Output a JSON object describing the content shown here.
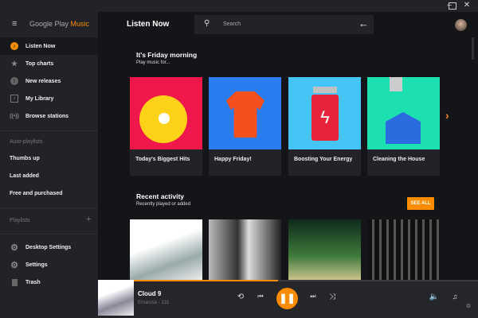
{
  "window": {
    "controls": [
      "minimize",
      "maximize",
      "close"
    ]
  },
  "sidebar": {
    "logo_google": "Google Play",
    "logo_music": "Music",
    "items": [
      {
        "label": "Listen Now",
        "icon": "listen-now-icon",
        "active": true
      },
      {
        "label": "Top charts",
        "icon": "star-icon"
      },
      {
        "label": "New releases",
        "icon": "new-releases-icon"
      },
      {
        "label": "My Library",
        "icon": "library-icon"
      },
      {
        "label": "Browse stations",
        "icon": "radio-icon"
      }
    ],
    "auto_playlists_header": "Auto-playlists",
    "auto_playlists": [
      "Thumbs up",
      "Last added",
      "Free and purchased"
    ],
    "playlists_header": "Playlists",
    "bottom": [
      {
        "label": "Desktop Settings",
        "icon": "gear-icon"
      },
      {
        "label": "Settings",
        "icon": "gear-icon"
      },
      {
        "label": "Trash",
        "icon": "trash-icon"
      }
    ]
  },
  "header": {
    "title": "Listen Now",
    "search_placeholder": "Search"
  },
  "friday": {
    "title": "It's Friday morning",
    "subtitle": "Play music for...",
    "cards": [
      {
        "label": "Today's Biggest Hits",
        "color": "#f0184a"
      },
      {
        "label": "Happy Friday!",
        "color": "#2a7cf0"
      },
      {
        "label": "Boosting Your Energy",
        "color": "#43c6f5"
      },
      {
        "label": "Cleaning the House",
        "color": "#1de0b0"
      }
    ]
  },
  "recent": {
    "title": "Recent activity",
    "subtitle": "Recently played or added",
    "see_all": "SEE ALL"
  },
  "player": {
    "track": "Cloud 9",
    "artist": "Emarosa - 131",
    "progress_percent": 42
  },
  "colors": {
    "accent": "#fb8c00",
    "sidebar": "#222328",
    "main": "#141518"
  }
}
